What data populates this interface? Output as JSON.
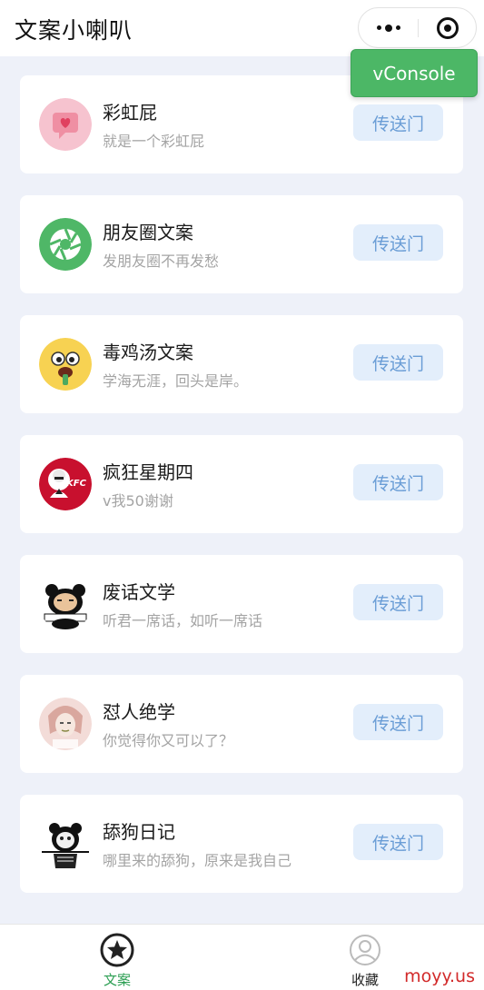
{
  "header": {
    "title": "文案小喇叭"
  },
  "vconsole": {
    "label": "vConsole"
  },
  "items": [
    {
      "name": "彩虹屁",
      "desc": "就是一个彩虹屁",
      "button": "传送门",
      "icon": "heart-chat-icon"
    },
    {
      "name": "朋友圈文案",
      "desc": "发朋友圈不再发愁",
      "button": "传送门",
      "icon": "aperture-icon"
    },
    {
      "name": "毒鸡汤文案",
      "desc": "学海无涯，回头是岸。",
      "button": "传送门",
      "icon": "drooling-emoji-icon"
    },
    {
      "name": "疯狂星期四",
      "desc": "v我50谢谢",
      "button": "传送门",
      "icon": "kfc-logo-icon"
    },
    {
      "name": "废话文学",
      "desc": "听君一席话，如听一席话",
      "button": "传送门",
      "icon": "panda-meme-icon"
    },
    {
      "name": "怼人绝学",
      "desc": "你觉得你又可以了？",
      "button": "传送门",
      "icon": "meme-face-icon"
    },
    {
      "name": "舔狗日记",
      "desc": "哪里来的舔狗，原来是我自己",
      "button": "传送门",
      "icon": "panda-stick-icon"
    }
  ],
  "tabbar": {
    "tabs": [
      {
        "label": "文案",
        "icon": "star-circle-icon",
        "active": true
      },
      {
        "label": "收藏",
        "icon": "person-circle-icon",
        "active": false
      }
    ]
  },
  "watermark": "moyy.us",
  "colors": {
    "accent": "#2b9e52",
    "button_bg": "#e3eefb",
    "button_text": "#6a9dd6",
    "vconsole": "#4cb766"
  }
}
